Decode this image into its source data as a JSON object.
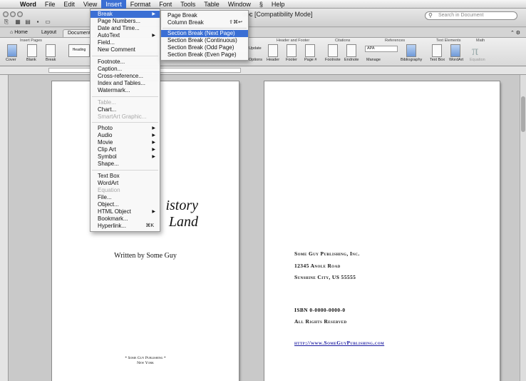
{
  "menubar": {
    "items": [
      "Word",
      "File",
      "Edit",
      "View",
      "Insert",
      "Format",
      "Font",
      "Tools",
      "Table",
      "Window",
      "Help"
    ]
  },
  "window": {
    "title": "doc [Compatibility Mode]",
    "search_placeholder": "Search in Document"
  },
  "ribbon": {
    "tabs": [
      "Home",
      "Layout",
      "Document"
    ],
    "groups": [
      "Insert Pages",
      "Header and Footer",
      "Citations",
      "References",
      "Text Elements",
      "Math"
    ],
    "buttons": [
      "Cover",
      "Blank",
      "Break",
      "Header",
      "Footer",
      "Page #",
      "Footnote",
      "Endnote",
      "Manage",
      "Bibliography",
      "Text Box",
      "WordArt",
      "Equation",
      "Update",
      "Options"
    ],
    "citation_style": "APA",
    "heading_preview": "Heading"
  },
  "insert_menu": {
    "items": [
      {
        "label": "Break",
        "state": "highlighted",
        "arrow": true
      },
      {
        "label": "Page Numbers..."
      },
      {
        "label": "Date and Time..."
      },
      {
        "label": "AutoText",
        "arrow": true
      },
      {
        "label": "Field..."
      },
      {
        "label": "New Comment"
      },
      {
        "label": "Footnote..."
      },
      {
        "label": "Caption..."
      },
      {
        "label": "Cross-reference..."
      },
      {
        "label": "Index and Tables..."
      },
      {
        "label": "Watermark..."
      },
      {
        "label": "Table...",
        "state": "disabled"
      },
      {
        "label": "Chart..."
      },
      {
        "label": "SmartArt Graphic...",
        "state": "disabled"
      },
      {
        "label": "Photo",
        "arrow": true
      },
      {
        "label": "Audio",
        "arrow": true
      },
      {
        "label": "Movie",
        "arrow": true
      },
      {
        "label": "Clip Art",
        "arrow": true
      },
      {
        "label": "Symbol",
        "arrow": true
      },
      {
        "label": "Shape..."
      },
      {
        "label": "Text Box"
      },
      {
        "label": "WordArt"
      },
      {
        "label": "Equation",
        "state": "disabled"
      },
      {
        "label": "File..."
      },
      {
        "label": "Object..."
      },
      {
        "label": "HTML Object",
        "arrow": true
      },
      {
        "label": "Bookmark..."
      },
      {
        "label": "Hyperlink...",
        "shortcut": "⌘K"
      }
    ]
  },
  "break_submenu": {
    "items": [
      {
        "label": "Page Break"
      },
      {
        "label": "Column Break",
        "shortcut": "⇧⌘↩"
      },
      {
        "label": "Section Break (Next Page)",
        "state": "highlighted"
      },
      {
        "label": "Section Break (Continuous)"
      },
      {
        "label": "Section Break (Odd Page)"
      },
      {
        "label": "Section Break (Even Page)"
      }
    ]
  },
  "page_left": {
    "title_line1": "istory",
    "title_line2": "Land",
    "author": "Written by Some Guy",
    "footer_line1": "* Some Guy Publishing *",
    "footer_line2": "New York"
  },
  "page_right": {
    "publisher": "Some Guy Publishing, Inc.",
    "address": "12345 Anole Road",
    "city": "Sunshine City, US 55555",
    "isbn": "ISBN 0-0000-0000-0",
    "rights": "All Rights Reserved",
    "url": "http://www.SomeGuyPublishing.com"
  },
  "colors": {
    "highlight": "#3b6fd4",
    "link": "#1a1aa0"
  }
}
